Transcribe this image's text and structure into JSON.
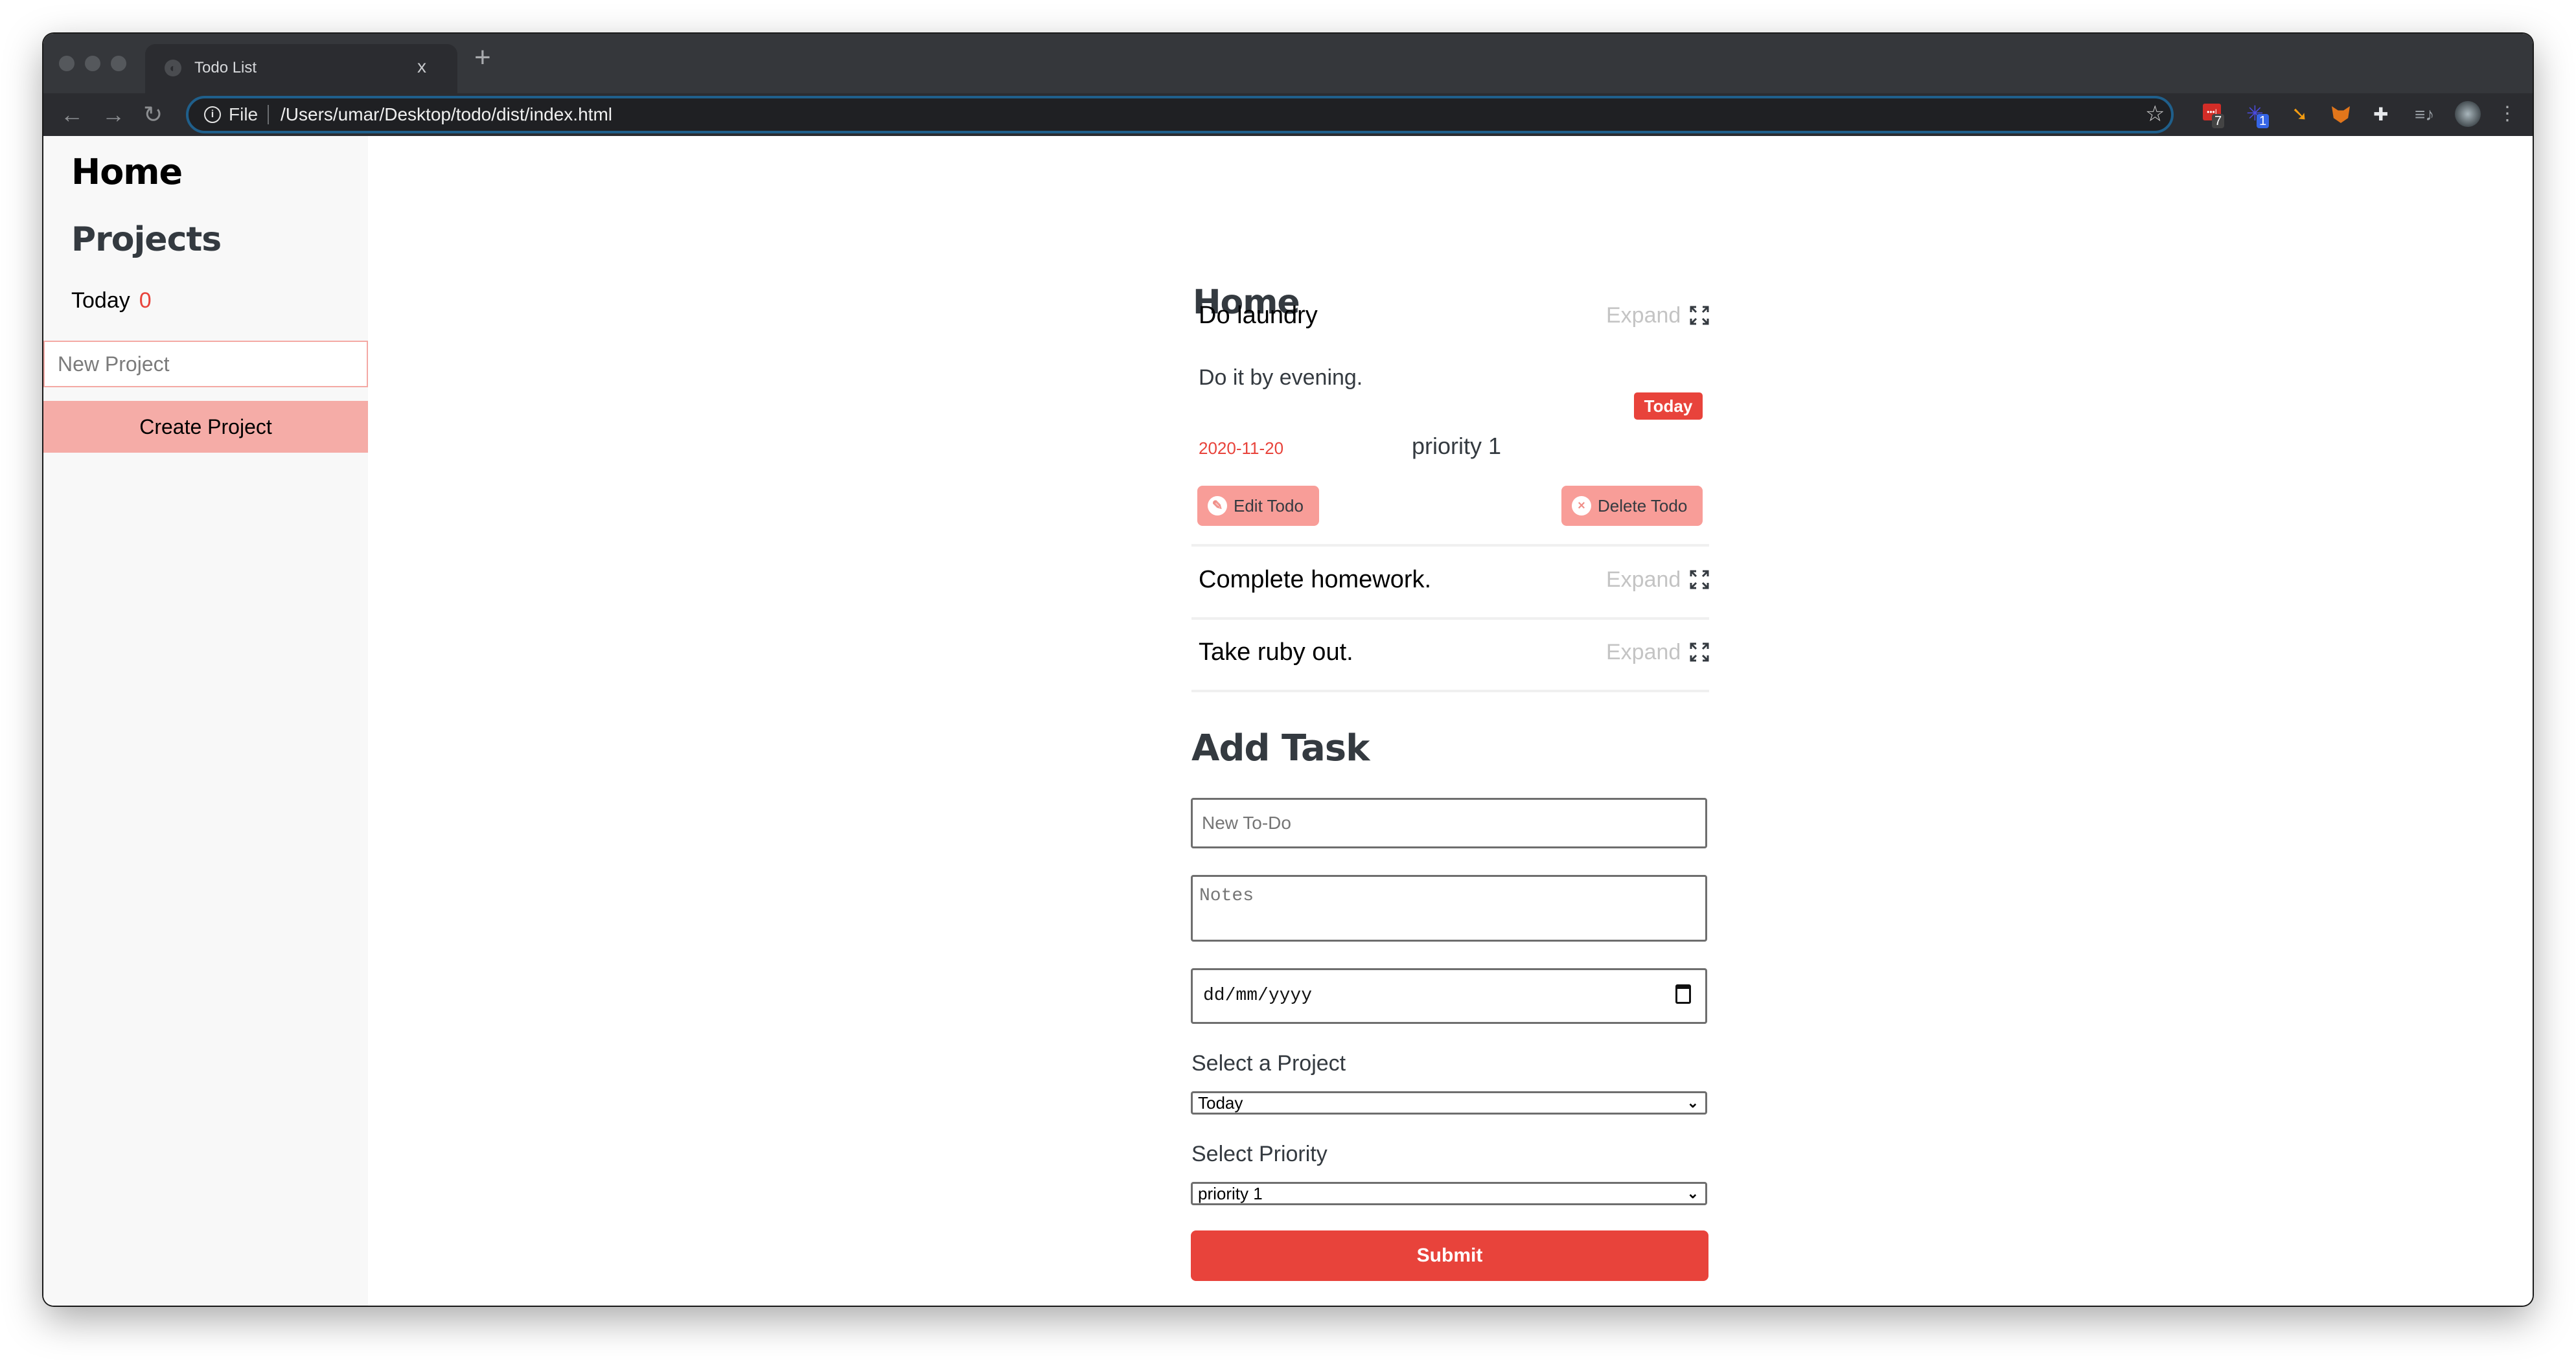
{
  "browser": {
    "tab": {
      "title": "Todo List",
      "close_glyph": "x",
      "favicon": "globe-icon"
    },
    "new_tab_glyph": "+",
    "nav": {
      "back": "←",
      "forward": "→",
      "reload": "↻"
    },
    "address": {
      "scheme_label": "File",
      "url": "/Users/umar/Desktop/todo/dist/index.html",
      "info_glyph": "i",
      "star_glyph": "☆"
    },
    "extensions": [
      {
        "name": "lastpass-extension",
        "badge": "7",
        "color": "#d32d27",
        "badge_color": "#444444"
      },
      {
        "name": "sparkle-extension",
        "badge": "1",
        "color": "#4b4bdf",
        "badge_color": "#3565e6"
      },
      {
        "name": "arrow-extension",
        "badge": "",
        "color": "#f39c12"
      },
      {
        "name": "metamask-extension",
        "badge": "",
        "color": "#e2761b"
      },
      {
        "name": "extensions-puzzle",
        "badge": "",
        "color": "#e8eaed"
      },
      {
        "name": "media-control",
        "badge": "",
        "color": "#9aa0a6"
      }
    ],
    "menu_glyph": "⋮"
  },
  "sidebar": {
    "home_label": "Home",
    "projects_heading": "Projects",
    "projects": [
      {
        "name": "Today",
        "count": "0"
      }
    ],
    "new_project_placeholder": "New Project",
    "new_project_value": "",
    "create_button": "Create Project"
  },
  "main": {
    "title": "Home",
    "expand_label": "Expand",
    "todos": [
      {
        "title": "Do laundry",
        "expanded": true,
        "notes": "Do it by evening.",
        "due_date": "2020-11-20",
        "priority": "priority 1",
        "project_badge": "Today",
        "edit_label": "Edit Todo",
        "delete_label": "Delete Todo"
      },
      {
        "title": "Complete homework.",
        "expanded": false
      },
      {
        "title": "Take ruby out.",
        "expanded": false
      }
    ]
  },
  "add_task": {
    "title": "Add Task",
    "todo_placeholder": "New To-Do",
    "notes_placeholder": "Notes",
    "date_placeholder": "dd/mm/yyyy",
    "project_label": "Select a Project",
    "project_selected": "Today",
    "priority_label": "Select Priority",
    "priority_selected": "priority 1",
    "submit_label": "Submit"
  },
  "colors": {
    "accent_red": "#e8433b",
    "pink_button": "#f89d98",
    "sidebar_button": "#f5aca7",
    "sidebar_bg": "#f8f8f8",
    "heading_dark": "#343a40",
    "muted": "#c4c4c4"
  }
}
